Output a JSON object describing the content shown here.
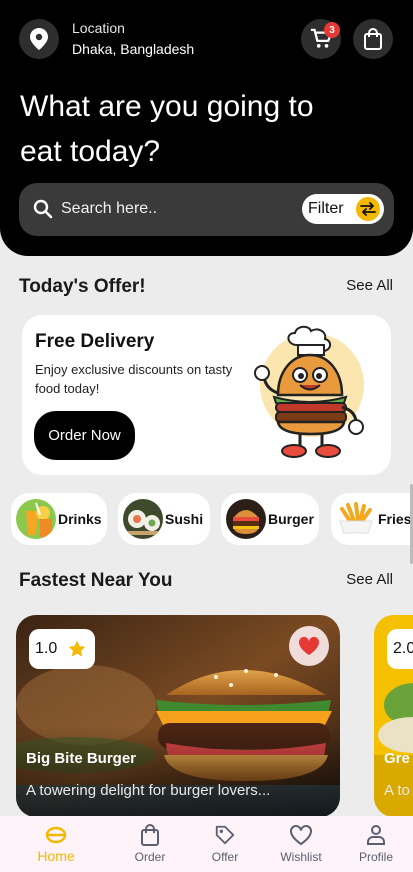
{
  "header": {
    "location_label": "Location",
    "location_value": "Dhaka, Bangladesh",
    "cart_count": "3",
    "headline": "What are you going to eat today?",
    "search_placeholder": "Search here..",
    "filter_label": "Filter"
  },
  "offers": {
    "title": "Today's Offer!",
    "see_all": "See All",
    "card": {
      "title": "Free Delivery",
      "text": "Enjoy exclusive discounts on tasty food today!",
      "button": "Order Now"
    }
  },
  "categories": [
    {
      "label": "Drinks"
    },
    {
      "label": "Sushi"
    },
    {
      "label": "Burger"
    },
    {
      "label": "Fries"
    }
  ],
  "nearby": {
    "title": "Fastest Near You",
    "see_all": "See All",
    "cards": [
      {
        "rating": "1.0",
        "name": "Big Bite Burger",
        "desc": "A towering delight for burger lovers..."
      },
      {
        "rating": "2.0",
        "name": "Gre",
        "desc": "A to"
      }
    ]
  },
  "nav": [
    {
      "label": "Home",
      "icon": "home-icon",
      "active": true
    },
    {
      "label": "Order",
      "icon": "bag-icon"
    },
    {
      "label": "Offer",
      "icon": "tag-icon"
    },
    {
      "label": "Wishlist",
      "icon": "heart-icon"
    },
    {
      "label": "Profile",
      "icon": "profile-icon"
    }
  ],
  "colors": {
    "accent": "#f5b800",
    "badge": "#e53935",
    "heart": "#e53935"
  }
}
